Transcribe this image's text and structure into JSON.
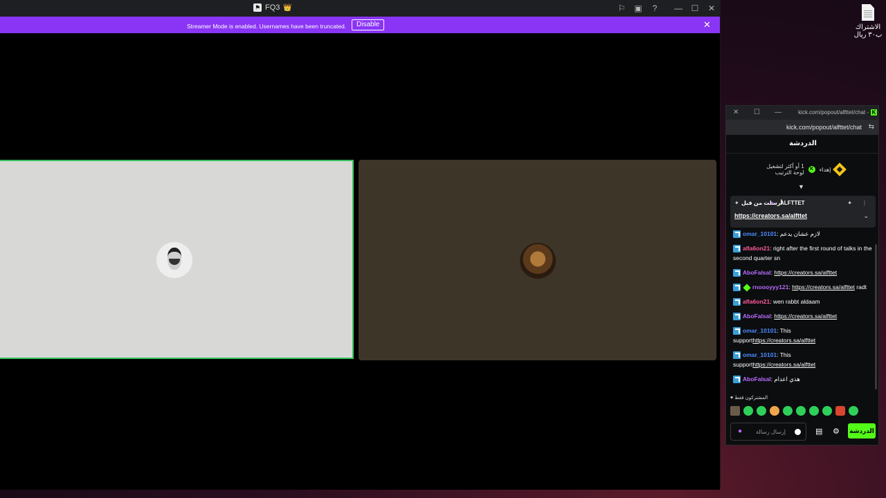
{
  "desktop": {
    "icon_label": "الاشتراك ب٣٠ ريال"
  },
  "main_window": {
    "title": "FQ3",
    "title_emoji": "👑",
    "banner": {
      "message": "Streamer Mode is enabled. Usernames have been truncated.",
      "button": "Disable"
    }
  },
  "chat_window": {
    "title": "kick.com/popout/alfttet/chat -",
    "url": "kick.com/popout/alfttet/chat",
    "header": "الدردشة",
    "sub_goal": {
      "prefix": "إهداء",
      "text": "1 أو أكثر لتشغيل لوحة الترتيب"
    },
    "pinned": {
      "pinned_by": "أرسلت من قبل",
      "username": "ALFTTET",
      "link": "https://creators.sa/alfttet"
    },
    "messages": [
      {
        "user": "omar_10101",
        "color": "#4a8cff",
        "text": "لازم عشان يدعم",
        "link": "",
        "gem": false
      },
      {
        "user": "afla6on21",
        "color": "#ff5a9a",
        "text": "right after the first round of talks in the second quarter sn",
        "link": "",
        "gem": false
      },
      {
        "user": "AboFalsal",
        "color": "#b86bff",
        "text": "",
        "link": "https://creators.sa/alfttet",
        "gem": false
      },
      {
        "user": "rnoooyyy121",
        "color": "#b86bff",
        "text": "radt",
        "link": "https://creators.sa/alfttet",
        "gem": true
      },
      {
        "user": "afla6on21",
        "color": "#ff5a9a",
        "text": "wen rabbt aldaam",
        "link": "",
        "gem": false
      },
      {
        "user": "AboFalsal",
        "color": "#b86bff",
        "text": "",
        "link": "https://creators.sa/alfttet",
        "gem": false
      },
      {
        "user": "omar_10101",
        "color": "#4a8cff",
        "text": "This support",
        "link": "https://creators.sa/alfttet",
        "gem": false
      },
      {
        "user": "omar_10101",
        "color": "#4a8cff",
        "text": "This support",
        "link": "https://creators.sa/alfttet",
        "gem": false
      },
      {
        "user": "AboFalsal",
        "color": "#b86bff",
        "text": "هذي اعدام",
        "link": "",
        "gem": false
      }
    ],
    "subs_only": "المشتركون فقط",
    "input_placeholder": "إرسال رسالة",
    "send_button": "الدردشة"
  },
  "colors": {
    "banner": "#8a35f5",
    "kick_green": "#53fc18",
    "speaking_border": "#36c15d"
  }
}
